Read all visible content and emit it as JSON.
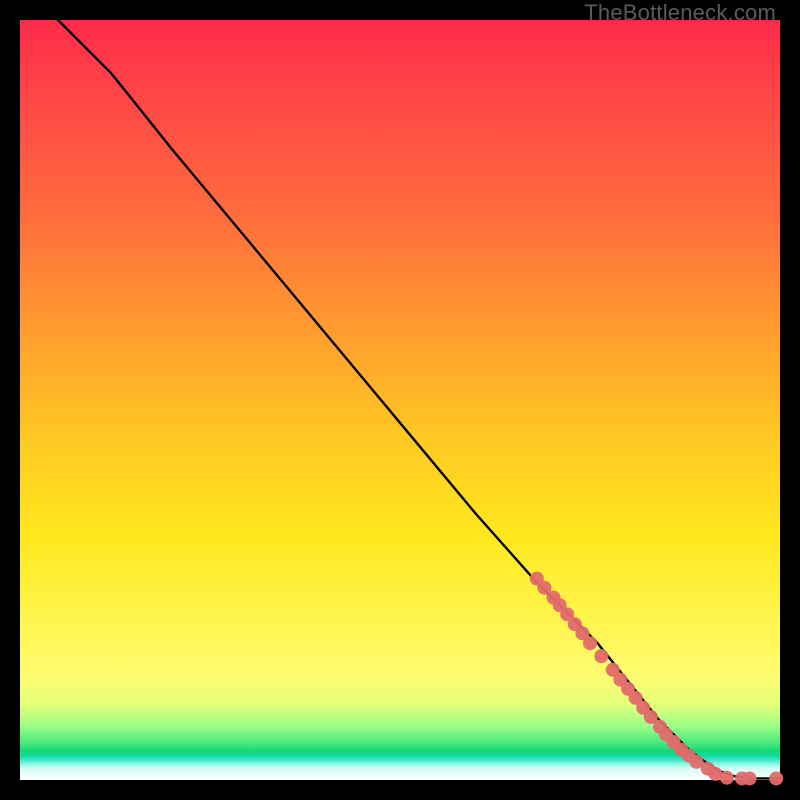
{
  "watermark": "TheBottleneck.com",
  "chart_data": {
    "type": "line",
    "title": "",
    "xlabel": "",
    "ylabel": "",
    "xlim": [
      0,
      100
    ],
    "ylim": [
      0,
      100
    ],
    "series": [
      {
        "name": "curve",
        "x": [
          5,
          8,
          12,
          20,
          30,
          40,
          50,
          60,
          68,
          72,
          76,
          80,
          84,
          86,
          88,
          90,
          92,
          94,
          96,
          100
        ],
        "y": [
          100,
          97,
          93,
          83,
          71,
          59,
          47,
          35,
          26,
          22,
          18,
          13,
          8,
          6,
          4,
          2.5,
          1.2,
          0.5,
          0.2,
          0.2
        ]
      }
    ],
    "scatter": [
      {
        "x": 68.0,
        "y": 26.5
      },
      {
        "x": 69.0,
        "y": 25.3
      },
      {
        "x": 70.2,
        "y": 24.0
      },
      {
        "x": 71.0,
        "y": 23.0
      },
      {
        "x": 72.0,
        "y": 21.8
      },
      {
        "x": 73.0,
        "y": 20.5
      },
      {
        "x": 74.0,
        "y": 19.3
      },
      {
        "x": 75.0,
        "y": 18.0
      },
      {
        "x": 76.5,
        "y": 16.3
      },
      {
        "x": 78.0,
        "y": 14.5
      },
      {
        "x": 79.0,
        "y": 13.2
      },
      {
        "x": 80.0,
        "y": 12.0
      },
      {
        "x": 81.0,
        "y": 10.8
      },
      {
        "x": 82.0,
        "y": 9.5
      },
      {
        "x": 83.0,
        "y": 8.3
      },
      {
        "x": 84.2,
        "y": 7.0
      },
      {
        "x": 85.0,
        "y": 6.0
      },
      {
        "x": 86.0,
        "y": 5.0
      },
      {
        "x": 87.0,
        "y": 4.0
      },
      {
        "x": 88.0,
        "y": 3.2
      },
      {
        "x": 89.0,
        "y": 2.4
      },
      {
        "x": 90.5,
        "y": 1.5
      },
      {
        "x": 91.5,
        "y": 0.8
      },
      {
        "x": 93.0,
        "y": 0.3
      },
      {
        "x": 95.0,
        "y": 0.2
      },
      {
        "x": 96.0,
        "y": 0.2
      },
      {
        "x": 99.5,
        "y": 0.2
      }
    ],
    "scatter_radius_px": 7
  },
  "colors": {
    "scatter": "#e26a6a",
    "curve": "#000000",
    "background_frame": "#000000"
  }
}
